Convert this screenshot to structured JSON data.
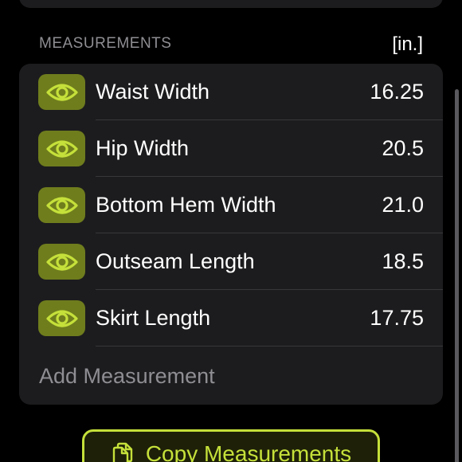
{
  "section": {
    "header": "MEASUREMENTS",
    "unit": "[in.]"
  },
  "measurements": [
    {
      "label": "Waist Width",
      "value": "16.25",
      "icon": "eye-icon"
    },
    {
      "label": "Hip Width",
      "value": "20.5",
      "icon": "eye-icon"
    },
    {
      "label": "Bottom Hem Width",
      "value": "21.0",
      "icon": "eye-icon"
    },
    {
      "label": "Outseam Length",
      "value": "18.5",
      "icon": "eye-icon"
    },
    {
      "label": "Skirt Length",
      "value": "17.75",
      "icon": "eye-icon"
    }
  ],
  "add_measurement": {
    "label": "Add Measurement"
  },
  "copy_button": {
    "label": "Copy Measurements",
    "icon": "copy-icon"
  },
  "colors": {
    "background": "#000000",
    "card": "#1c1c1e",
    "accent": "#c5e03a",
    "eye_button_bg": "#6f7d1d",
    "secondary_text": "#8e8e93"
  }
}
